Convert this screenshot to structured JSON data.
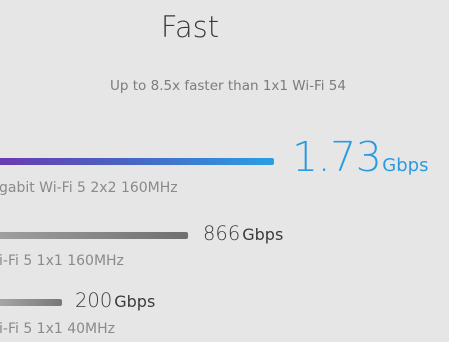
{
  "header": {
    "title": "Fast",
    "subtitle": "Up to 8.5x faster than 1x1 Wi-Fi 54"
  },
  "comparisons": [
    {
      "value": "1.73",
      "unit": "Gbps",
      "caption": "gabit Wi-Fi 5 2x2 160MHz",
      "color": "#2a9be0"
    },
    {
      "value": "866",
      "unit": "Gbps",
      "caption": "i-Fi 5 1x1 160MHz",
      "color": "#3a3a3a"
    },
    {
      "value": "200",
      "unit": "Gbps",
      "caption": "i-Fi 5 1x1 40MHz",
      "color": "#3a3a3a"
    }
  ]
}
